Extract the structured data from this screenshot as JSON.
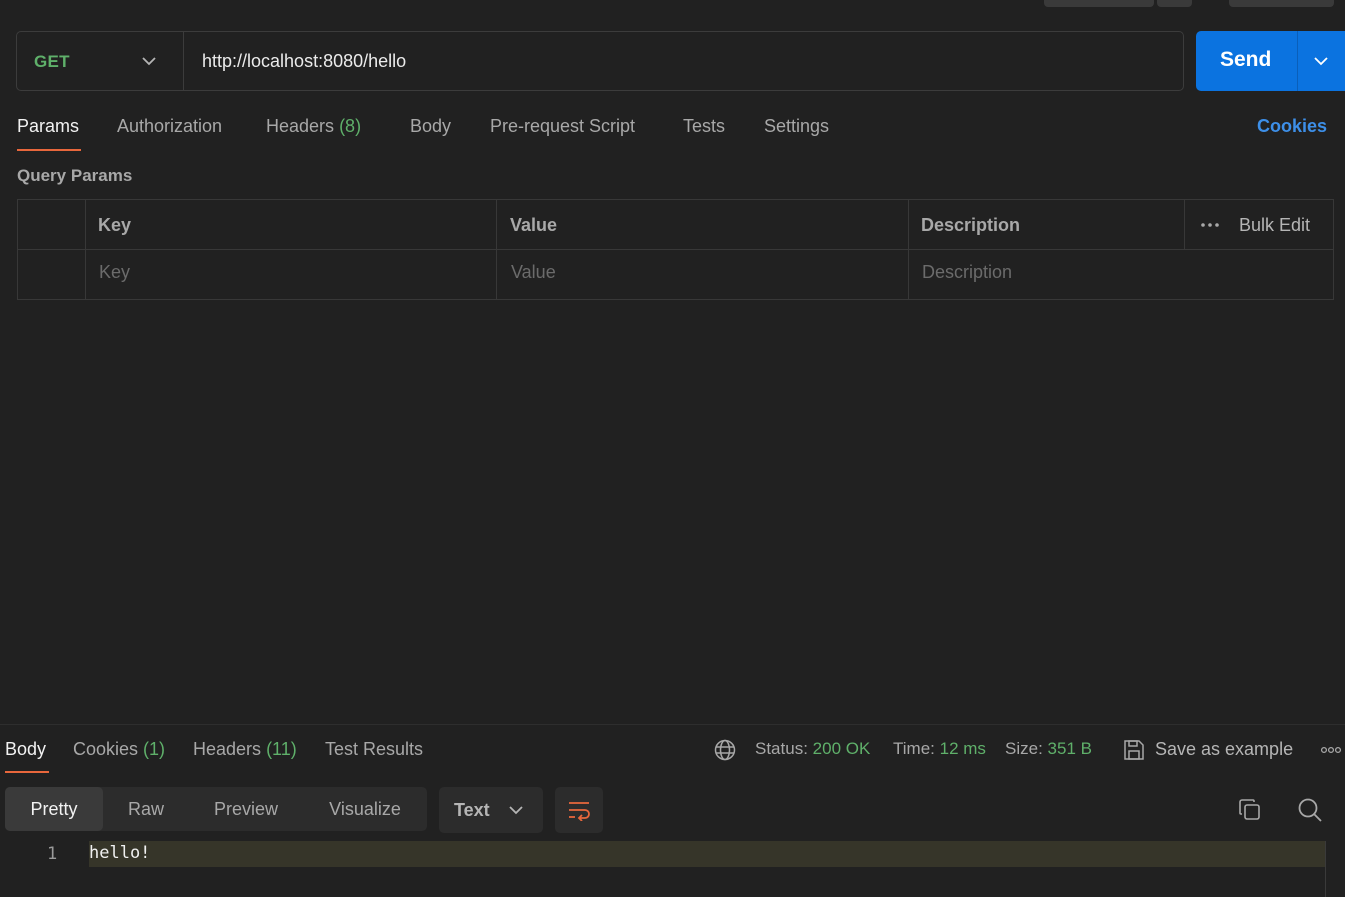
{
  "request": {
    "method": "GET",
    "url": "http://localhost:8080/hello",
    "send_label": "Send"
  },
  "request_tabs": [
    {
      "label": "Params",
      "active": true
    },
    {
      "label": "Authorization"
    },
    {
      "label": "Headers",
      "count": "(8)"
    },
    {
      "label": "Body"
    },
    {
      "label": "Pre-request Script"
    },
    {
      "label": "Tests"
    },
    {
      "label": "Settings"
    }
  ],
  "cookies_link": "Cookies",
  "query_params": {
    "title": "Query Params",
    "columns": [
      "Key",
      "Value",
      "Description"
    ],
    "bulk_edit": "Bulk Edit",
    "placeholders": {
      "key": "Key",
      "value": "Value",
      "description": "Description"
    }
  },
  "response": {
    "tabs": [
      {
        "label": "Body",
        "active": true
      },
      {
        "label": "Cookies",
        "count": "(1)"
      },
      {
        "label": "Headers",
        "count": "(11)"
      },
      {
        "label": "Test Results"
      }
    ],
    "status_label": "Status:",
    "status_value": "200 OK",
    "time_label": "Time:",
    "time_value": "12 ms",
    "size_label": "Size:",
    "size_value": "351 B",
    "save_example": "Save as example",
    "views": [
      "Pretty",
      "Raw",
      "Preview",
      "Visualize"
    ],
    "active_view": "Pretty",
    "format": "Text",
    "body_lines": [
      {
        "number": "1",
        "text": "hello!"
      }
    ]
  },
  "colors": {
    "accent": "#e8673c",
    "send": "#0b73e0",
    "success": "#5fb06a",
    "link": "#3d8fe8"
  }
}
